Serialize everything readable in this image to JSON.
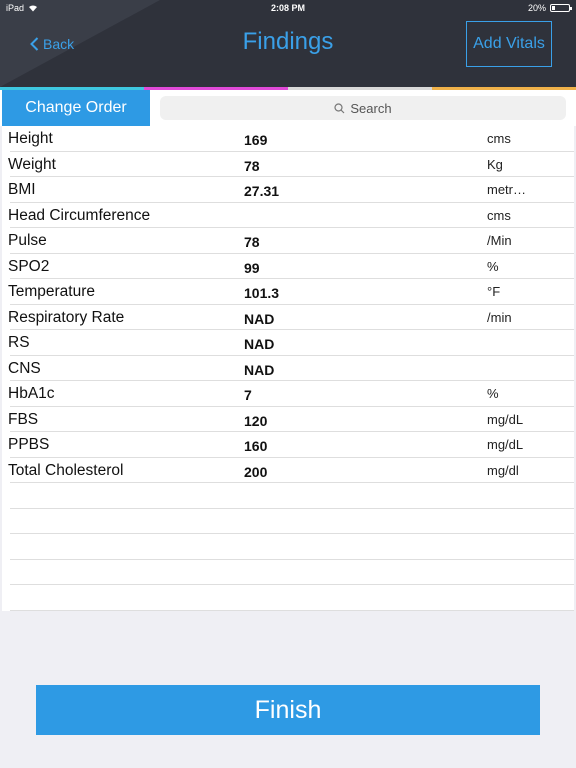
{
  "statusbar": {
    "device": "iPad",
    "time": "2:08 PM",
    "battery": "20%",
    "battery_level": 0.2
  },
  "header": {
    "back_label": "Back",
    "title": "Findings",
    "add_vitals_label": "Add Vitals"
  },
  "colors": {
    "accent": "#3aa0e8",
    "button": "#2e9ae4",
    "strip": [
      "#3ec7e0",
      "#e04ad8",
      "#d9d9d9",
      "#f0b24a"
    ]
  },
  "toolbar": {
    "change_order_label": "Change Order",
    "search_placeholder": "Search"
  },
  "findings": [
    {
      "name": "Height",
      "value": "169",
      "unit": "cms"
    },
    {
      "name": "Weight",
      "value": "78",
      "unit": "Kg"
    },
    {
      "name": "BMI",
      "value": "27.31",
      "unit": "metr…"
    },
    {
      "name": "Head Circumference",
      "value": "",
      "unit": "cms"
    },
    {
      "name": "Pulse",
      "value": "78",
      "unit": "/Min"
    },
    {
      "name": "SPO2",
      "value": "99",
      "unit": "%"
    },
    {
      "name": "Temperature",
      "value": "101.3",
      "unit": "°F"
    },
    {
      "name": "Respiratory Rate",
      "value": "NAD",
      "unit": "/min"
    },
    {
      "name": "RS",
      "value": "NAD",
      "unit": ""
    },
    {
      "name": "CNS",
      "value": "NAD",
      "unit": ""
    },
    {
      "name": "HbA1c",
      "value": "7",
      "unit": "%"
    },
    {
      "name": "FBS",
      "value": "120",
      "unit": "mg/dL"
    },
    {
      "name": "PPBS",
      "value": "160",
      "unit": "mg/dL"
    },
    {
      "name": "Total Cholesterol",
      "value": "200",
      "unit": "mg/dl"
    },
    {
      "name": "",
      "value": "",
      "unit": ""
    },
    {
      "name": "",
      "value": "",
      "unit": ""
    },
    {
      "name": "",
      "value": "",
      "unit": ""
    },
    {
      "name": "",
      "value": "",
      "unit": ""
    },
    {
      "name": "",
      "value": "",
      "unit": ""
    }
  ],
  "footer": {
    "finish_label": "Finish"
  }
}
